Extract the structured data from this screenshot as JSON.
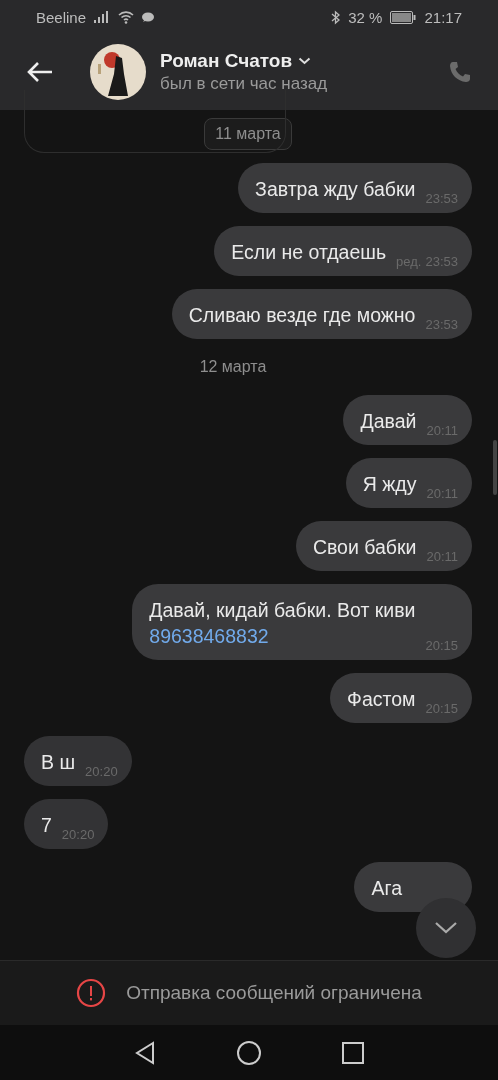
{
  "status_bar": {
    "carrier": "Beeline",
    "battery": "32 %",
    "time": "21:17"
  },
  "header": {
    "name": "Роман Счатов",
    "status": "был в сети час назад"
  },
  "messages": [
    {
      "kind": "date",
      "text": "11 марта",
      "floating": true
    },
    {
      "kind": "message",
      "outgoing": true,
      "text": "Завтра жду бабки",
      "time": "23:53"
    },
    {
      "kind": "message",
      "outgoing": true,
      "text": "Если не отдаешь",
      "edited": "ред.",
      "time": "23:53"
    },
    {
      "kind": "message",
      "outgoing": true,
      "text": "Сливаю везде где можно",
      "time": "23:53"
    },
    {
      "kind": "date",
      "text": "12 марта",
      "floating": false
    },
    {
      "kind": "message",
      "outgoing": true,
      "text": "Давай",
      "time": "20:11"
    },
    {
      "kind": "message",
      "outgoing": true,
      "text": "Я жду",
      "time": "20:11"
    },
    {
      "kind": "message",
      "outgoing": true,
      "text": "Свои бабки",
      "time": "20:11"
    },
    {
      "kind": "message",
      "outgoing": true,
      "text": "Давай, кидай бабки. Вот киви",
      "link": "89638468832",
      "time": "20:15"
    },
    {
      "kind": "message",
      "outgoing": true,
      "text": "Фастом",
      "time": "20:15"
    },
    {
      "kind": "message",
      "outgoing": false,
      "text": "В ш",
      "time": "20:20"
    },
    {
      "kind": "message",
      "outgoing": false,
      "text": "7",
      "time": "20:20"
    },
    {
      "kind": "message",
      "outgoing": true,
      "text": "Ага"
    }
  ],
  "notice": "Отправка сообщений ограничена"
}
